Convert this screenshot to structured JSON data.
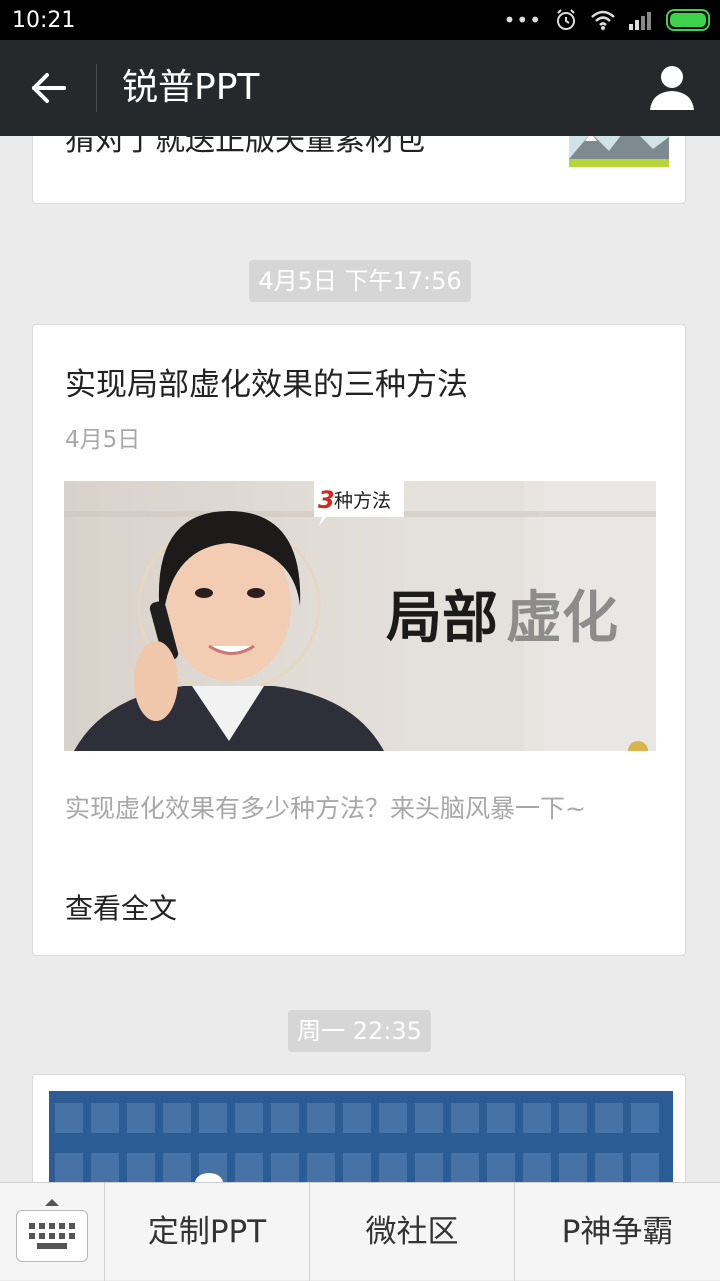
{
  "status_bar": {
    "time": "10:21",
    "dots": "•••"
  },
  "header": {
    "title": "锐普PPT"
  },
  "previous_card": {
    "title": "猜对了就送正版矢量素材包"
  },
  "timeline": [
    {
      "timestamp": "4月5日 下午17:56"
    },
    {
      "timestamp": "周一 22:35"
    }
  ],
  "article": {
    "title": "实现局部虚化效果的三种方法",
    "date": "4月5日",
    "image_badge_num": "3",
    "image_badge_text": "种方法",
    "image_heading_dark": "局部",
    "image_heading_light": "虚化",
    "summary": "实现虚化效果有多少种方法？来头脑风暴一下~",
    "read_more": "查看全文"
  },
  "bottom_nav": {
    "items": [
      {
        "label": "定制PPT"
      },
      {
        "label": "微社区"
      },
      {
        "label": "P神争霸"
      }
    ]
  },
  "colors": {
    "header_bg": "#26292b",
    "page_bg": "#ebebeb",
    "battery": "#3bd34a",
    "timestamp_bg": "#d6d6d6"
  }
}
